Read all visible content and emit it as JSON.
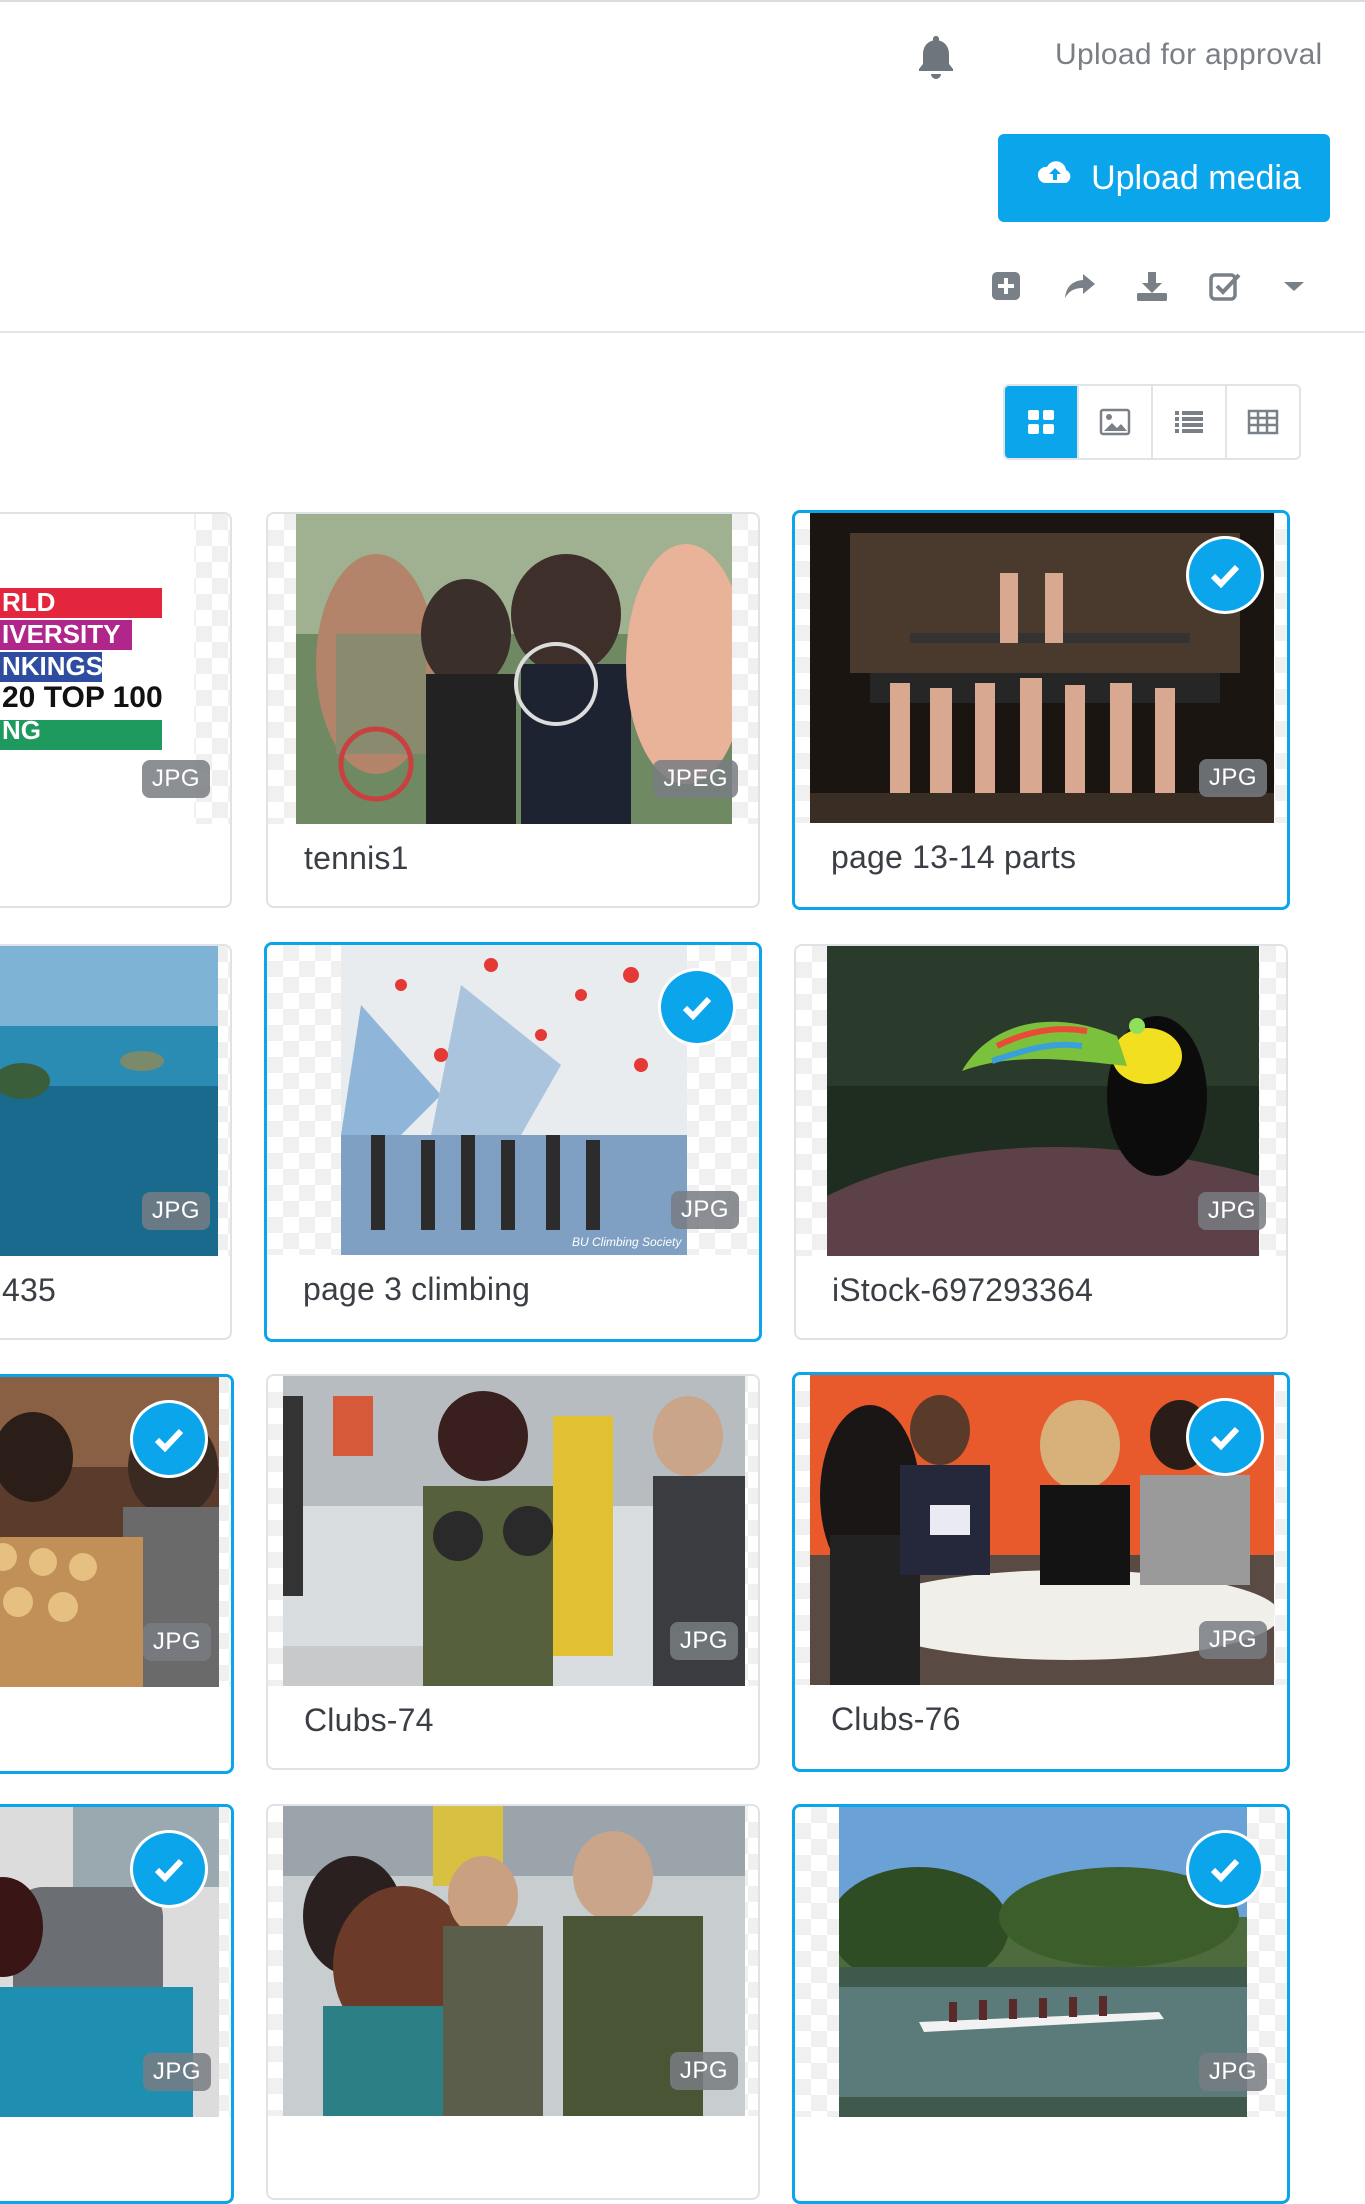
{
  "header": {
    "upload_for_approval": "Upload for approval",
    "upload_media_label": "Upload media",
    "toolbar_icons": [
      "plus-square-icon",
      "share-icon",
      "download-icon",
      "check-square-icon",
      "caret-down-icon"
    ]
  },
  "view_toggle": {
    "options": [
      "grid-view",
      "image-view",
      "list-view",
      "table-view"
    ],
    "active": "grid-view"
  },
  "colors": {
    "accent": "#0ba5ec",
    "border": "#dfe2e6",
    "badge_bg": "#787c82"
  },
  "media": {
    "items": [
      {
        "title": "",
        "format": "JPG",
        "selected": false
      },
      {
        "title": "tennis1",
        "format": "JPEG",
        "selected": false
      },
      {
        "title": "page 13-14 parts",
        "format": "JPG",
        "selected": true
      },
      {
        "title": "435",
        "format": "JPG",
        "selected": false
      },
      {
        "title": "page 3 climbing",
        "format": "JPG",
        "selected": true
      },
      {
        "title": "iStock-697293364",
        "format": "JPG",
        "selected": false
      },
      {
        "title": "",
        "format": "JPG",
        "selected": true
      },
      {
        "title": "Clubs-74",
        "format": "JPG",
        "selected": false
      },
      {
        "title": "Clubs-76",
        "format": "JPG",
        "selected": true
      },
      {
        "title": "",
        "format": "JPG",
        "selected": true
      },
      {
        "title": "",
        "format": "JPG",
        "selected": false
      },
      {
        "title": "",
        "format": "JPG",
        "selected": true
      }
    ],
    "ranking_image_text": [
      "RLD",
      "IVERSITY",
      "NKINGS",
      "20 TOP 100",
      "NG"
    ],
    "climbing_caption": "BU Climbing Society"
  }
}
